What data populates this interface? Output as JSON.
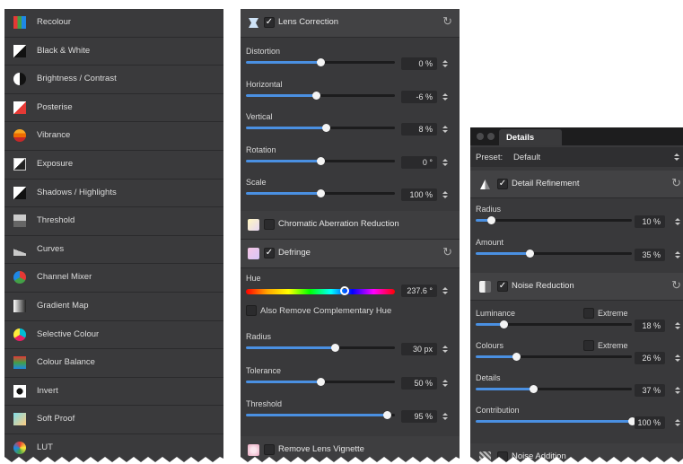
{
  "adjustments_list": {
    "items": [
      {
        "label": "Recolour",
        "icon": "recolour-icon"
      },
      {
        "label": "Black & White",
        "icon": "black-white-icon"
      },
      {
        "label": "Brightness / Contrast",
        "icon": "brightness-contrast-icon"
      },
      {
        "label": "Posterise",
        "icon": "posterise-icon"
      },
      {
        "label": "Vibrance",
        "icon": "vibrance-icon"
      },
      {
        "label": "Exposure",
        "icon": "exposure-icon"
      },
      {
        "label": "Shadows / Highlights",
        "icon": "shadows-highlights-icon"
      },
      {
        "label": "Threshold",
        "icon": "threshold-icon"
      },
      {
        "label": "Curves",
        "icon": "curves-icon"
      },
      {
        "label": "Channel Mixer",
        "icon": "channel-mixer-icon"
      },
      {
        "label": "Gradient Map",
        "icon": "gradient-map-icon"
      },
      {
        "label": "Selective Colour",
        "icon": "selective-colour-icon"
      },
      {
        "label": "Colour Balance",
        "icon": "colour-balance-icon"
      },
      {
        "label": "Invert",
        "icon": "invert-icon"
      },
      {
        "label": "Soft Proof",
        "icon": "soft-proof-icon"
      },
      {
        "label": "LUT",
        "icon": "lut-icon"
      }
    ]
  },
  "lens_panel": {
    "lens_correction": {
      "title": "Lens Correction",
      "checked": true,
      "params": [
        {
          "label": "Distortion",
          "value": "0 %",
          "level": 0.5
        },
        {
          "label": "Horizontal",
          "value": "-6 %",
          "level": 0.47
        },
        {
          "label": "Vertical",
          "value": "8 %",
          "level": 0.54
        },
        {
          "label": "Rotation",
          "value": "0 °",
          "level": 0.5
        },
        {
          "label": "Scale",
          "value": "100 %",
          "level": 0.5
        }
      ]
    },
    "chromatic": {
      "title": "Chromatic Aberration Reduction",
      "checked": false
    },
    "defringe": {
      "title": "Defringe",
      "checked": true,
      "hue_label": "Hue",
      "hue_value": "237.6 °",
      "hue_level": 0.66,
      "complementary_label": "Also Remove Complementary Hue",
      "params": [
        {
          "label": "Radius",
          "value": "30 px",
          "level": 0.6
        },
        {
          "label": "Tolerance",
          "value": "50 %",
          "level": 0.5
        },
        {
          "label": "Threshold",
          "value": "95 %",
          "level": 0.95
        }
      ]
    },
    "vignette": {
      "title": "Remove Lens Vignette",
      "checked": false
    }
  },
  "details_panel": {
    "tab_title": "Details",
    "preset_label": "Preset:",
    "preset_value": "Default",
    "detail_refinement": {
      "title": "Detail Refinement",
      "checked": true,
      "params": [
        {
          "label": "Radius",
          "value": "10 %",
          "level": 0.1
        },
        {
          "label": "Amount",
          "value": "35 %",
          "level": 0.35
        }
      ]
    },
    "noise_reduction": {
      "title": "Noise Reduction",
      "checked": true,
      "extreme_label": "Extreme",
      "params": [
        {
          "label": "Luminance",
          "value": "18 %",
          "level": 0.18,
          "extreme": true
        },
        {
          "label": "Colours",
          "value": "26 %",
          "level": 0.26,
          "extreme": true
        },
        {
          "label": "Details",
          "value": "37 %",
          "level": 0.37,
          "extreme": false
        },
        {
          "label": "Contribution",
          "value": "100 %",
          "level": 1.0,
          "extreme": false
        }
      ]
    },
    "noise_addition": {
      "title": "Noise Addition",
      "checked": false
    }
  },
  "colors": {
    "panel": "#3a3a3c",
    "accent": "#4a90e2",
    "knob": "#f4f4f4"
  }
}
